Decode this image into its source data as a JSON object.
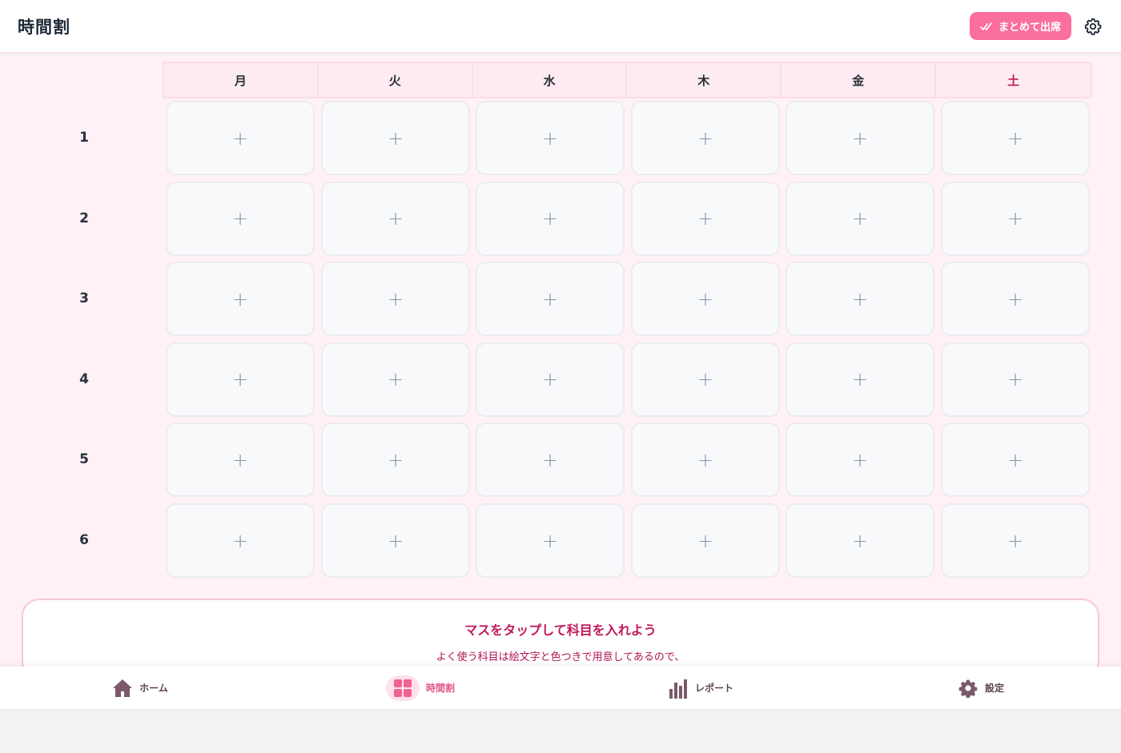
{
  "header": {
    "title": "時間割",
    "bulk_attend_label": "まとめて出席"
  },
  "timetable": {
    "days": [
      "月",
      "火",
      "水",
      "木",
      "金",
      "土"
    ],
    "periods": [
      "1",
      "2",
      "3",
      "4",
      "5",
      "6"
    ],
    "empty_cell_symbol": "+"
  },
  "hint": {
    "title": "マスをタップして科目を入れよう",
    "body": "よく使う科目は絵文字と色つきで用意してあるので、"
  },
  "nav": {
    "items": [
      {
        "label": "ホーム",
        "icon": "home-icon"
      },
      {
        "label": "時間割",
        "icon": "grid-icon",
        "active": true
      },
      {
        "label": "レポート",
        "icon": "bar-chart-icon"
      },
      {
        "label": "設定",
        "icon": "gear-icon"
      }
    ]
  },
  "colors": {
    "accent": "#fb6f9f",
    "background": "#fff1f5",
    "saturday": "#c2185b"
  }
}
